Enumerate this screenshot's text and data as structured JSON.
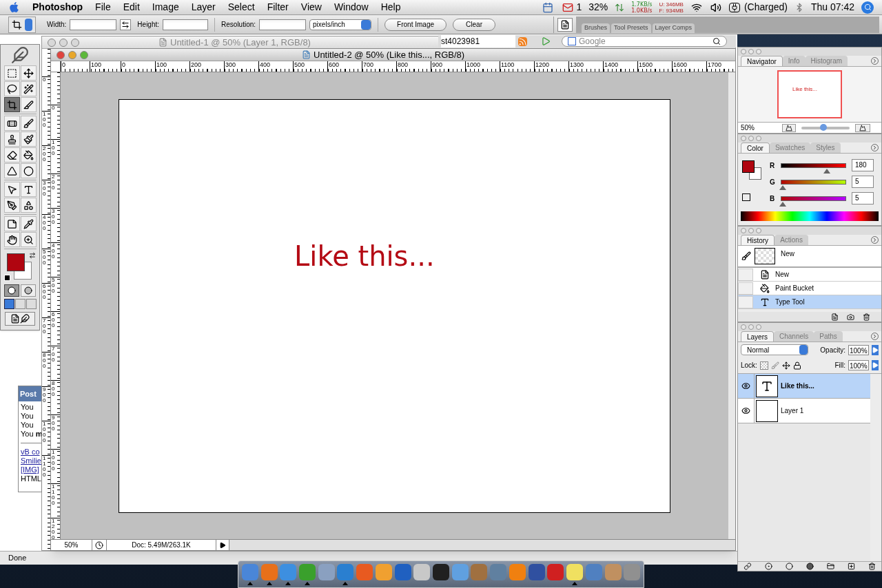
{
  "menu_bar": {
    "app": "Photoshop",
    "menus": [
      "File",
      "Edit",
      "Image",
      "Layer",
      "Select",
      "Filter",
      "View",
      "Window",
      "Help"
    ],
    "mail_count": "1",
    "cpu": "32%",
    "net_up": "1.7KB/s",
    "net_down": "1.0KB/s",
    "mem_used_label": "U:",
    "mem_used": "346MB",
    "mem_free_label": "F:",
    "mem_free": "934MB",
    "battery": "(Charged)",
    "clock": "Thu 07:42"
  },
  "options_bar": {
    "width_label": "Width:",
    "height_label": "Height:",
    "resolution_label": "Resolution:",
    "unit": "pixels/inch",
    "buttons": [
      "Front Image",
      "Clear"
    ],
    "well_tabs": [
      "Brushes",
      "Tool Presets",
      "Layer Comps"
    ]
  },
  "browser": {
    "address_fragment": "st4023981",
    "search_placeholder": "Google",
    "post_header": "Post",
    "post_lines": [
      "You",
      "You",
      "You",
      "You **m**"
    ],
    "links": [
      "vB co",
      "Smilie",
      "[IMG]"
    ],
    "note": "HTML",
    "status": "Done"
  },
  "background_window": {
    "title": "Untitled-1 @ 50% (Layer 1, RGB/8)",
    "ruler_v": [
      "0",
      "100",
      "200",
      "300",
      "400",
      "500",
      "600",
      "700",
      "800",
      "900",
      "1000",
      "1100"
    ]
  },
  "document": {
    "title": "Untitled-2 @ 50% (Like this..., RGB/8)",
    "ruler_h": [
      "0",
      "100",
      "0",
      "100",
      "200",
      "300",
      "400",
      "500",
      "600",
      "700",
      "800",
      "900",
      "1000",
      "1100",
      "1200",
      "1300",
      "1400",
      "1500",
      "1600",
      "1700"
    ],
    "ruler_v": [
      "0",
      "100",
      "200",
      "300",
      "400",
      "500",
      "600",
      "700",
      "800",
      "900",
      "1000",
      "1100",
      "1200"
    ],
    "canvas_text": "Like this...",
    "zoom": "50%",
    "doc_info": "Doc: 5.49M/263.1K"
  },
  "toolbox": {
    "tool_groups": [
      [
        {
          "kind": "marquee",
          "selected": false
        },
        {
          "kind": "move",
          "selected": false
        },
        {
          "kind": "lasso",
          "selected": false
        },
        {
          "kind": "wand",
          "selected": false
        },
        {
          "kind": "crop",
          "selected": true
        },
        {
          "kind": "slice",
          "selected": false
        }
      ],
      [
        {
          "kind": "healing",
          "selected": false
        },
        {
          "kind": "brush",
          "selected": false
        },
        {
          "kind": "stamp",
          "selected": false
        },
        {
          "kind": "history",
          "selected": false
        },
        {
          "kind": "eraser",
          "selected": false
        },
        {
          "kind": "bucket",
          "selected": false
        },
        {
          "kind": "blur",
          "selected": false
        },
        {
          "kind": "dodge",
          "selected": false
        }
      ],
      [
        {
          "kind": "pointer",
          "selected": false
        },
        {
          "kind": "type",
          "selected": false
        },
        {
          "kind": "pen",
          "selected": false
        },
        {
          "kind": "shape",
          "selected": false
        }
      ],
      [
        {
          "kind": "notes",
          "selected": false
        },
        {
          "kind": "eyedropper",
          "selected": false
        },
        {
          "kind": "hand",
          "selected": false
        },
        {
          "kind": "zoom",
          "selected": false
        }
      ]
    ],
    "colors": [
      {
        "kind": "foreground",
        "color": "#b00510"
      },
      {
        "kind": "background",
        "color": "#ffffff"
      }
    ],
    "mask_modes": [
      {
        "selected": true
      },
      {
        "selected": false
      }
    ],
    "screen_modes": [
      {
        "selected": true
      },
      {
        "selected": false
      },
      {
        "selected": false
      }
    ]
  },
  "navigator": {
    "tabs": [
      {
        "label": "Navigator",
        "selected": true
      },
      {
        "label": "Info",
        "selected": false
      },
      {
        "label": "Histogram",
        "selected": false
      }
    ],
    "preview_text": "Like this...",
    "zoom": "50%",
    "level": 0.45
  },
  "color_panel": {
    "tabs": [
      {
        "label": "Color",
        "selected": true
      },
      {
        "label": "Swatches",
        "selected": false
      },
      {
        "label": "Styles",
        "selected": false
      }
    ],
    "channels": [
      {
        "label": "R",
        "value": "180",
        "level": 0.706
      },
      {
        "label": "G",
        "value": "5",
        "level": 0.02
      },
      {
        "label": "B",
        "value": "5",
        "level": 0.02
      }
    ]
  },
  "history": {
    "tabs": [
      {
        "label": "History",
        "selected": true
      },
      {
        "label": "Actions",
        "selected": false
      }
    ],
    "snapshot": "New",
    "items": [
      {
        "kind": "new",
        "label": "New",
        "selected": false
      },
      {
        "kind": "bucket",
        "label": "Paint Bucket",
        "selected": false
      },
      {
        "kind": "type",
        "label": "Type Tool",
        "selected": true
      }
    ]
  },
  "layers": {
    "tabs": [
      {
        "label": "Layers",
        "selected": true
      },
      {
        "label": "Channels",
        "selected": false
      },
      {
        "label": "Paths",
        "selected": false
      }
    ],
    "blend_mode": "Normal",
    "opacity_label": "Opacity:",
    "opacity": "100%",
    "lock_label": "Lock:",
    "fill_label": "Fill:",
    "fill": "100%",
    "items": [
      {
        "kind": "text",
        "name": "Like this...",
        "visible": true,
        "selected": true
      },
      {
        "kind": "pixel",
        "name": "Layer 1",
        "visible": true,
        "selected": false
      }
    ]
  },
  "dock": [
    {
      "color": "#4a86d8",
      "running": true
    },
    {
      "color": "#e8701a",
      "running": true
    },
    {
      "color": "#3d8fe0",
      "running": true
    },
    {
      "color": "#3aa02c",
      "running": true
    },
    {
      "color": "#8aa0c0",
      "running": false
    },
    {
      "color": "#2a7fd0",
      "running": true
    },
    {
      "color": "#e85a20",
      "running": false
    },
    {
      "color": "#f0a030",
      "running": false
    },
    {
      "color": "#2060c0",
      "running": false
    },
    {
      "color": "#c8c8c8",
      "running": false
    },
    {
      "color": "#202020",
      "running": false
    },
    {
      "color": "#60a0e0",
      "running": false
    },
    {
      "color": "#a07040",
      "running": false
    },
    {
      "color": "#6080a0",
      "running": false
    },
    {
      "color": "#f08010",
      "running": false
    },
    {
      "color": "#3050a0",
      "running": false
    },
    {
      "color": "#d02020",
      "running": false
    },
    {
      "color": "#f0e060",
      "running": true
    },
    {
      "color": "#5080c0",
      "running": false
    },
    {
      "color": "#c09060",
      "running": false
    },
    {
      "color": "#909090",
      "running": false
    }
  ]
}
